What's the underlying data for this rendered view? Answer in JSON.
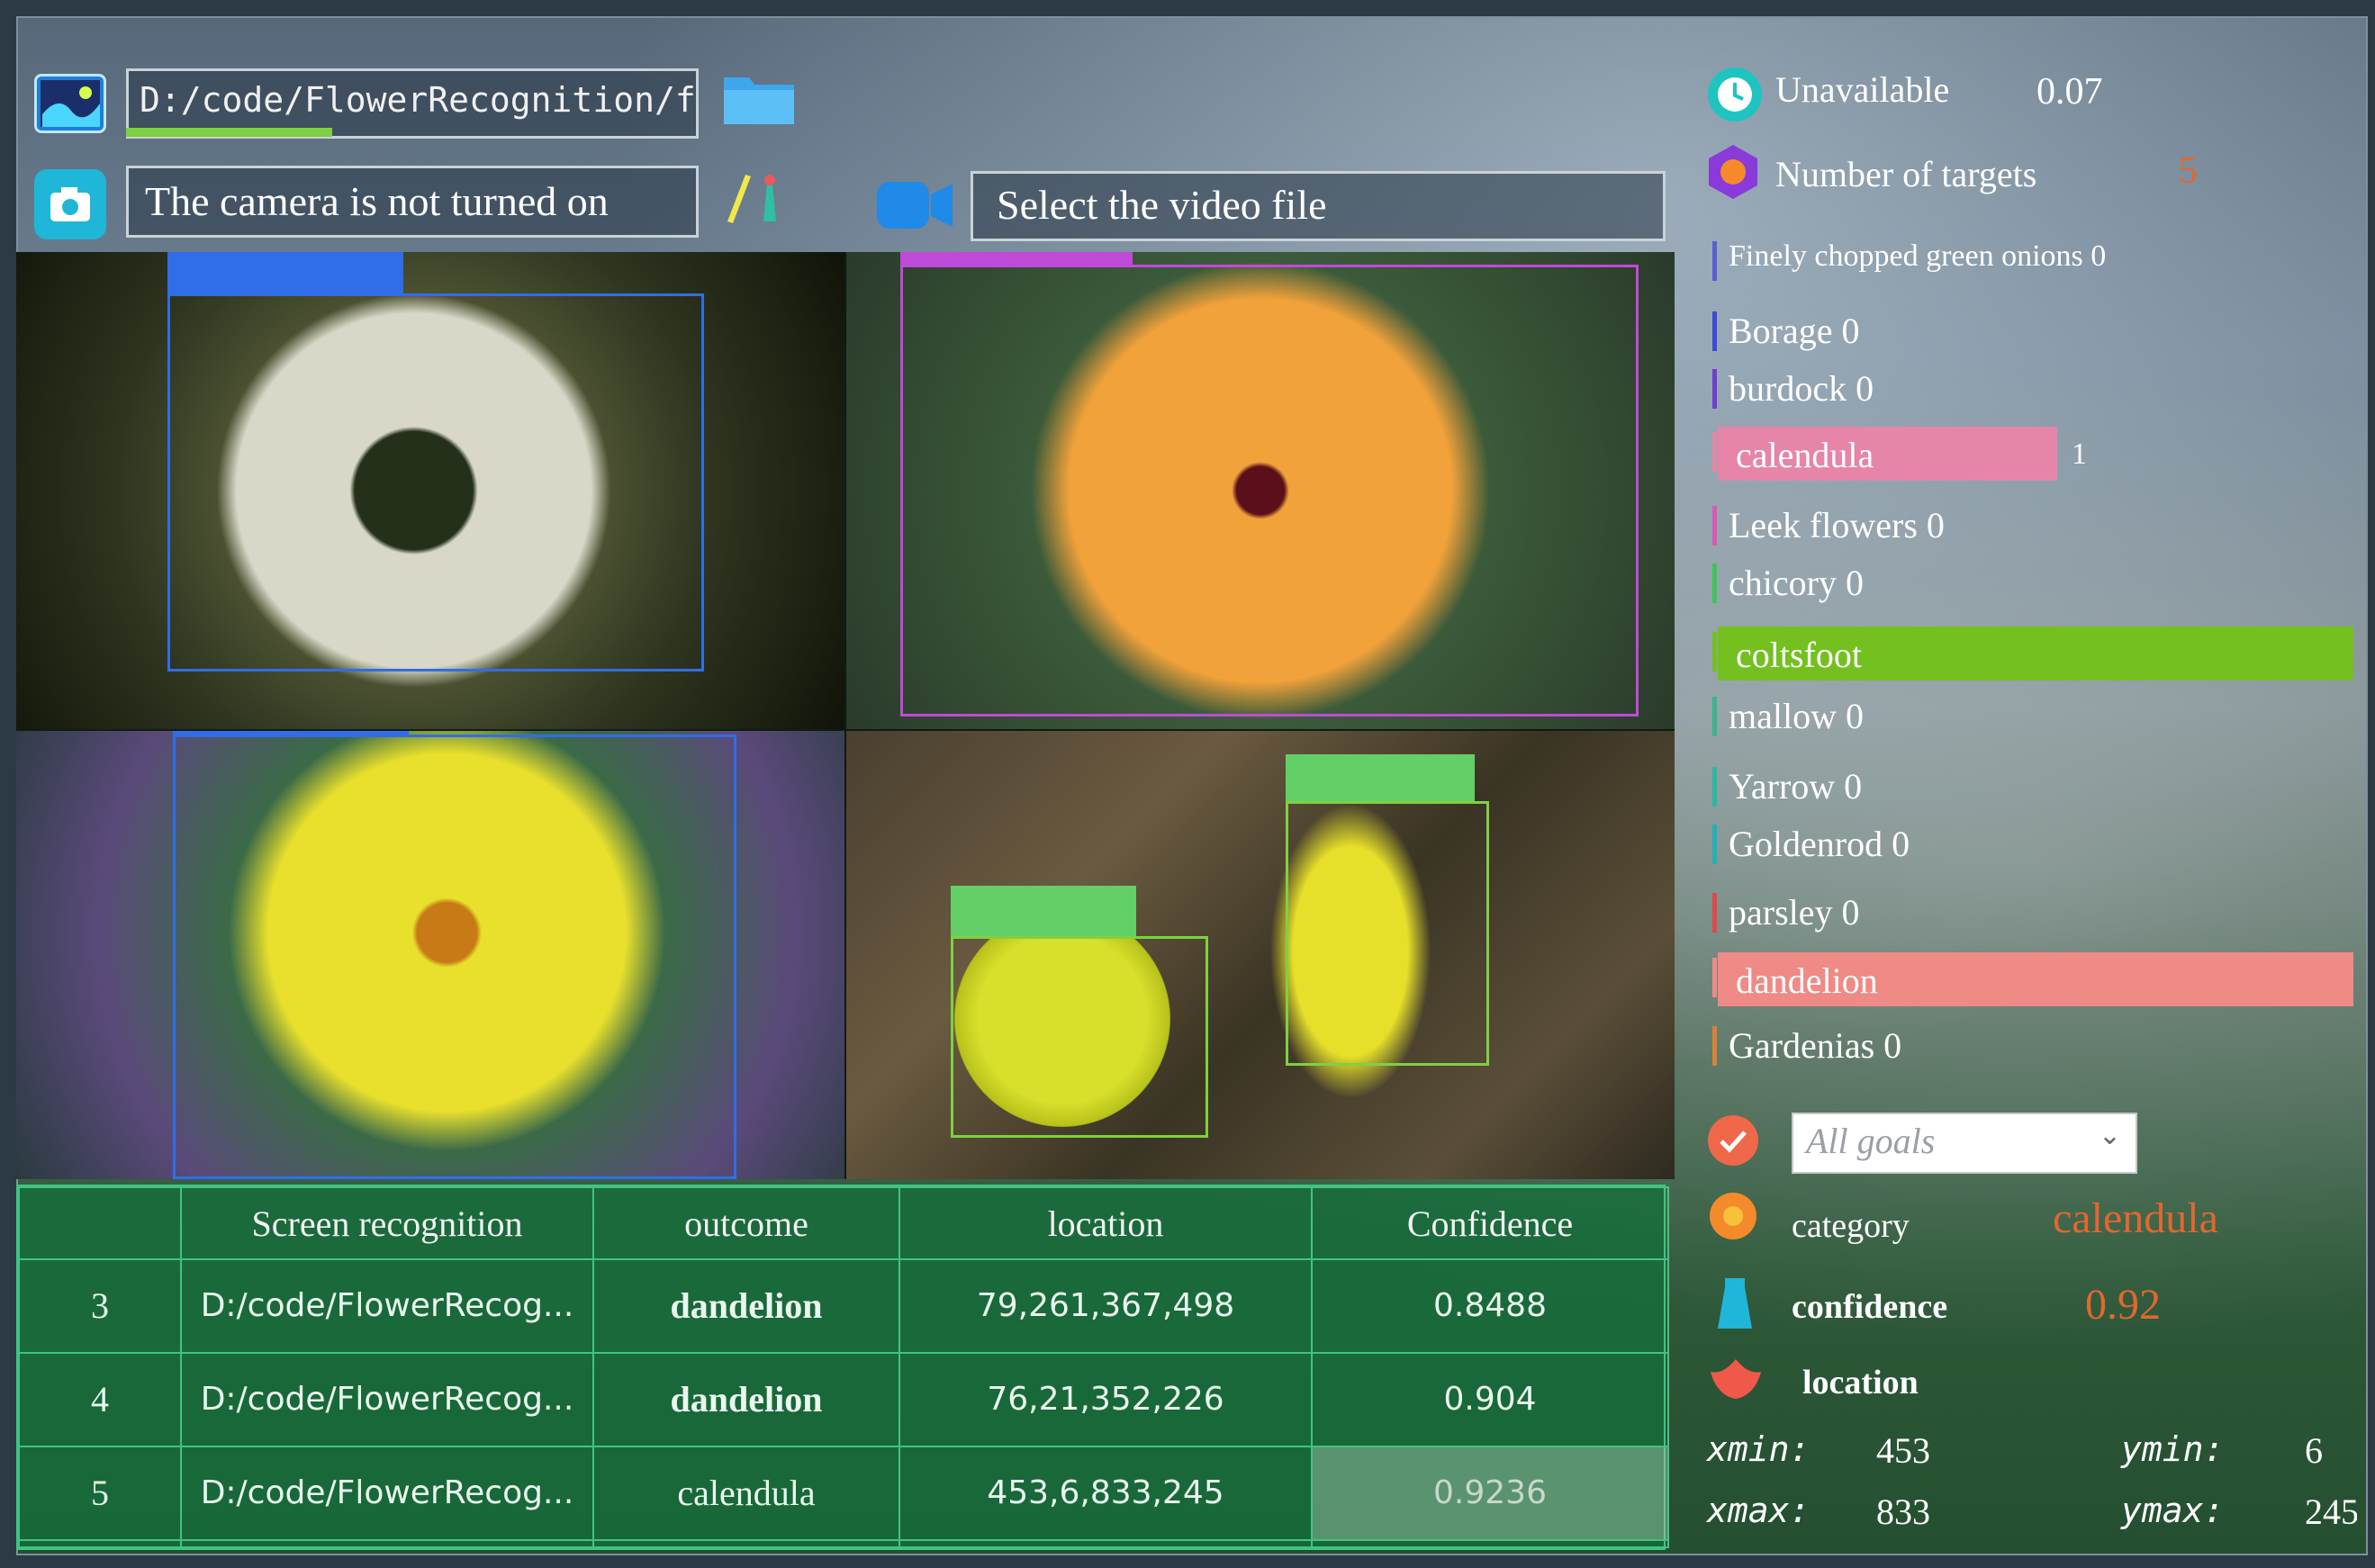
{
  "toolbar": {
    "path_value": "D:/code/FlowerRecognition/f",
    "path_progress": 0.36,
    "camera_status": "The camera is not turned on",
    "video_placeholder": "Select the video file"
  },
  "stats": {
    "time_label": "Unavailable",
    "time_value": "0.07",
    "targets_label": "Number of targets",
    "targets_value": "5"
  },
  "classes": [
    {
      "label": "Finely chopped green onions 0",
      "color": "#5b5fd6"
    },
    {
      "label": "Borage 0",
      "color": "#3b4bd8"
    },
    {
      "label": "burdock 0",
      "color": "#6e3fd0"
    },
    {
      "label": "calendula",
      "count": "1",
      "color": "#e685a8",
      "bar": 0.16
    },
    {
      "label": "Leek flowers 0",
      "color": "#d65ab5"
    },
    {
      "label": "chicory 0",
      "color": "#3fc459"
    },
    {
      "label": "coltsfoot",
      "color": "#74c01f",
      "bar": 0.3
    },
    {
      "label": "mallow 0",
      "color": "#3bb48c"
    },
    {
      "label": "Yarrow 0",
      "color": "#2fb6a4"
    },
    {
      "label": "Goldenrod 0",
      "color": "#23b0b6"
    },
    {
      "label": "parsley 0",
      "color": "#e0484c"
    },
    {
      "label": "dandelion",
      "color": "#ef8a86",
      "bar": 0.3
    },
    {
      "label": "Gardenias 0",
      "color": "#d9823a"
    }
  ],
  "filter": {
    "selected": "All goals"
  },
  "detail": {
    "category_label": "category",
    "category_value": "calendula",
    "confidence_label": "confidence",
    "confidence_value": "0.92",
    "location_label": "location",
    "xmin_label": "xmin:",
    "xmin_value": "453",
    "ymin_label": "ymin:",
    "ymin_value": "6",
    "xmax_label": "xmax:",
    "xmax_value": "833",
    "ymax_label": "ymax:",
    "ymax_value": "245"
  },
  "table": {
    "headers": [
      "",
      "Screen recognition",
      "outcome",
      "location",
      "Confidence"
    ],
    "rows": [
      [
        "3",
        "D:/code/FlowerRecog...",
        "dandelion",
        "79,261,367,498",
        "0.8488"
      ],
      [
        "4",
        "D:/code/FlowerRecog...",
        "dandelion",
        "76,21,352,226",
        "0.904"
      ],
      [
        "5",
        "D:/code/FlowerRecog...",
        "calendula",
        "453,6,833,245",
        "0.9236"
      ]
    ]
  },
  "colors": {
    "accent_cyan": "#1fb6d8",
    "selected_value": "#e3672d",
    "box_blue": "#2f6ee8",
    "box_purple": "#c04ad8",
    "box_green": "#7fd043"
  }
}
